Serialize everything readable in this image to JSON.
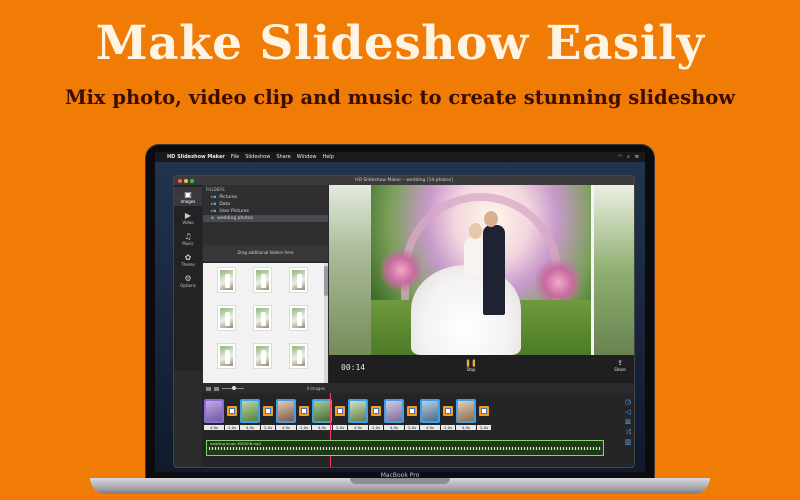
{
  "promo": {
    "headline": "Make Slideshow Easily",
    "subline": "Mix photo, video clip and music to create stunning slideshow"
  },
  "device": {
    "label": "MacBook Pro"
  },
  "menubar": {
    "apple_icon": "apple-icon",
    "app_name": "HD Slideshow Maker",
    "items": [
      "File",
      "Slideshow",
      "Share",
      "Window",
      "Help"
    ]
  },
  "window": {
    "title": "HD Slideshow Maker – wedding [14 photos]",
    "traffic_colors": [
      "#ff5f57",
      "#febc2e",
      "#28c840"
    ]
  },
  "sidebar": {
    "items": [
      {
        "label": "Images",
        "icon": "image-icon",
        "active": true
      },
      {
        "label": "Video",
        "icon": "video-icon",
        "active": false
      },
      {
        "label": "Music",
        "icon": "music-icon",
        "active": false
      },
      {
        "label": "Theme",
        "icon": "theme-icon",
        "active": false
      },
      {
        "label": "Options",
        "icon": "gear-icon",
        "active": false
      }
    ]
  },
  "folders": {
    "header": "FOLDERS",
    "items": [
      "Pictures",
      "Data",
      "User Pictures",
      "wedding photos"
    ],
    "selected": "wedding photos",
    "dropzone": "Drag additional folders here"
  },
  "grid": {
    "count_label": "4 Images"
  },
  "player": {
    "time": "00:14",
    "stop_label": "Stop",
    "share_label": "Share"
  },
  "timeline": {
    "clips": [
      "4.0s",
      "4.0s",
      "4.0s",
      "4.0s",
      "4.0s",
      "4.0s",
      "4.0s",
      "4.0s"
    ],
    "transitions": [
      "2.0s",
      "2.0s",
      "2.0s",
      "2.0s",
      "2.0s",
      "2.0s",
      "2.0s",
      "2.0s"
    ],
    "audio_name": "wedding music MISSION.mp3"
  },
  "colors": {
    "background": "#f07c06",
    "accent": "#f5a024",
    "playhead": "#ff3b5c"
  }
}
